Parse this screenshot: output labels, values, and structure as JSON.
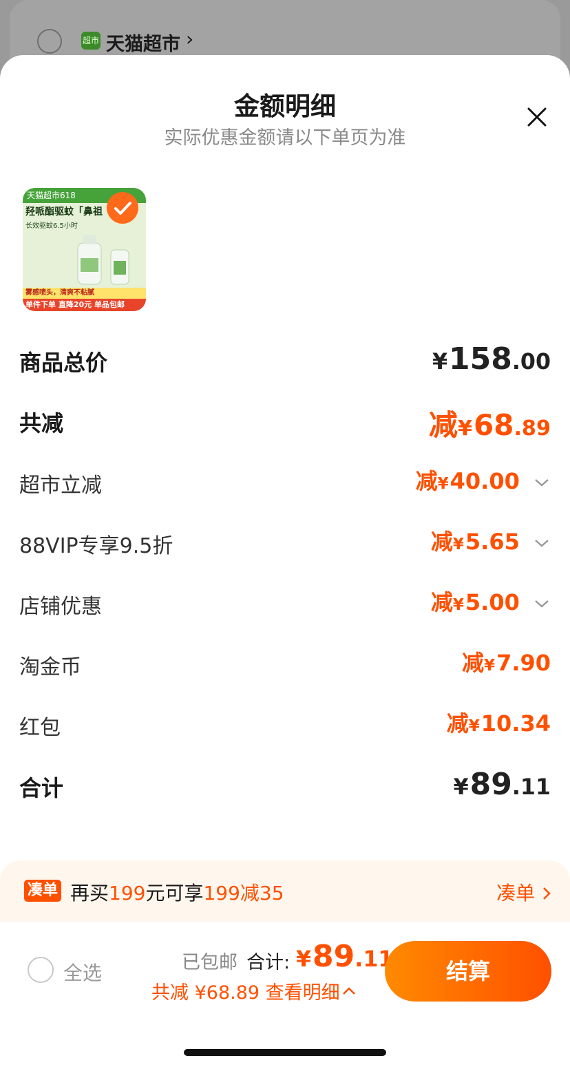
{
  "background_shop": {
    "logo_text": "超市",
    "name": "天猫超市",
    "chevron": "›"
  },
  "sheet": {
    "title": "金额明细",
    "subtitle": "实际优惠金额请以下单页为准"
  },
  "product": {
    "badge_text": "天猫超市618",
    "headline": "羟哌酯驱蚊「鼻祖",
    "line": "长效驱蚊6.5小时",
    "foot1": "雾感喷头，清爽不粘腻",
    "foot2": "单件下单 直降20元 单品包邮",
    "selected": true
  },
  "rows": [
    {
      "label": "商品总价",
      "prefix": "",
      "yen": "¥",
      "int": "158",
      "dec": ".00",
      "expandable": false
    },
    {
      "label": "共减",
      "prefix": "减",
      "yen": "¥",
      "int": "68",
      "dec": ".89",
      "expandable": false
    },
    {
      "label": "超市立减",
      "prefix": "减",
      "yen": "¥",
      "int": "40",
      "dec": ".00",
      "expandable": true
    },
    {
      "label": "88VIP专享9.5折",
      "prefix": "减",
      "yen": "¥",
      "int": "5",
      "dec": ".65",
      "expandable": true
    },
    {
      "label": "店铺优惠",
      "prefix": "减",
      "yen": "¥",
      "int": "5",
      "dec": ".00",
      "expandable": true
    },
    {
      "label": "淘金币",
      "prefix": "减",
      "yen": "¥",
      "int": "7",
      "dec": ".90",
      "expandable": false
    },
    {
      "label": "红包",
      "prefix": "减",
      "yen": "¥",
      "int": "10",
      "dec": ".34",
      "expandable": false
    },
    {
      "label": "合计",
      "prefix": "",
      "yen": "¥",
      "int": "89",
      "dec": ".11",
      "expandable": false
    }
  ],
  "promo": {
    "tag": "凑单",
    "text_1": "再买",
    "amount": "199",
    "text_2": "元可享",
    "deal": "199减35",
    "link": "凑单"
  },
  "bottom": {
    "select_all": "全选",
    "shipping": "已包邮",
    "total_label": "合计:",
    "total_yen": "¥",
    "total_int": "89",
    "total_dec": ".11",
    "saved_text": "共减",
    "saved_amount": "¥68.89",
    "detail_link": "查看明细",
    "checkout": "结算"
  },
  "colors": {
    "accent": "#ff5000",
    "promo_bg": "#fff7ee",
    "overlay": "#9a9a9a"
  }
}
